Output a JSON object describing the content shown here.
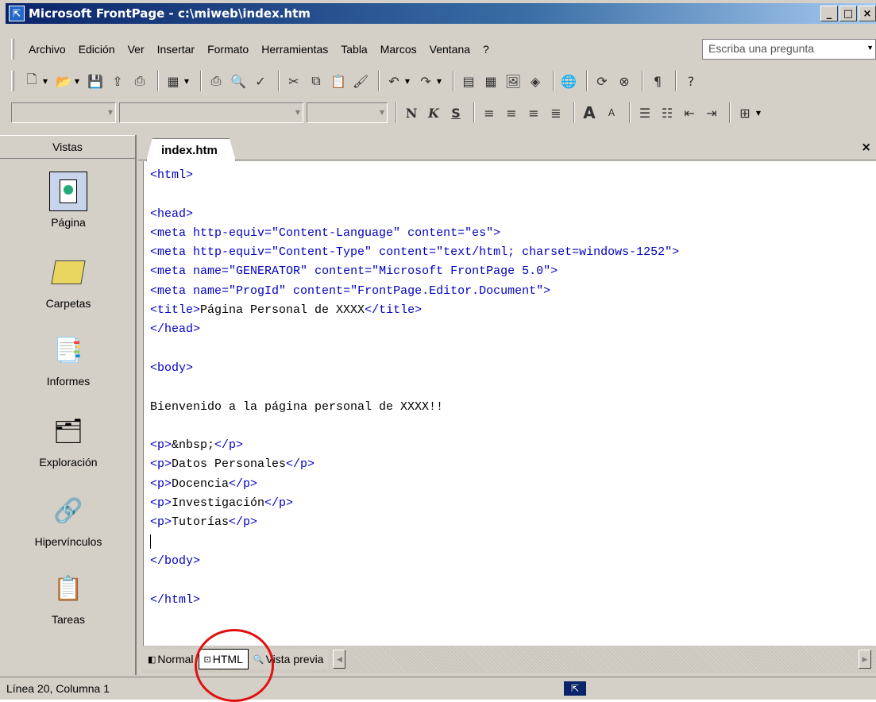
{
  "window": {
    "title": "Microsoft FrontPage - c:\\miweb\\index.htm",
    "app_icon": "frontpage-icon",
    "buttons": {
      "minimize": "_",
      "maximize": "□",
      "close": "×"
    }
  },
  "menubar": {
    "items": [
      "Archivo",
      "Edición",
      "Ver",
      "Insertar",
      "Formato",
      "Herramientas",
      "Tabla",
      "Marcos",
      "Ventana",
      "?"
    ],
    "ask_placeholder": "Escriba una pregunta"
  },
  "toolbar_icons": {
    "standard": [
      "new-page-icon",
      "open-icon",
      "save-icon",
      "publish-icon",
      "print-preview-icon",
      "insert-component-icon",
      "print-icon",
      "preview-in-browser-icon",
      "spelling-icon",
      "cut-icon",
      "copy-icon",
      "paste-icon",
      "format-painter-icon",
      "undo-icon",
      "redo-icon",
      "web-component-icon",
      "table-icon",
      "picture-icon",
      "drawing-icon",
      "hyperlink-icon",
      "refresh-icon",
      "stop-icon",
      "show-all-icon",
      "help-icon"
    ],
    "formatting": [
      "style-combo",
      "font-combo",
      "size-combo",
      "bold-button",
      "italic-button",
      "underline-button",
      "align-left-icon",
      "center-icon",
      "align-right-icon",
      "justify-icon",
      "increase-font-icon",
      "decrease-font-icon",
      "numbering-icon",
      "bullets-icon",
      "decrease-indent-icon",
      "increase-indent-icon",
      "borders-icon"
    ]
  },
  "formatting_labels": {
    "bold": "N",
    "italic": "K",
    "underline": "S"
  },
  "views_pane": {
    "header": "Vistas",
    "items": [
      {
        "label": "Página",
        "icon": "page-view-icon",
        "selected": true
      },
      {
        "label": "Carpetas",
        "icon": "folders-view-icon"
      },
      {
        "label": "Informes",
        "icon": "reports-view-icon"
      },
      {
        "label": "Exploración",
        "icon": "navigation-view-icon"
      },
      {
        "label": "Hipervínculos",
        "icon": "hyperlinks-view-icon"
      },
      {
        "label": "Tareas",
        "icon": "tasks-view-icon"
      }
    ]
  },
  "document": {
    "tab_label": "index.htm",
    "close_label": "×",
    "code": [
      "<html>",
      "",
      "<head>",
      "<meta http-equiv=\"Content-Language\" content=\"es\">",
      "<meta http-equiv=\"Content-Type\" content=\"text/html; charset=windows-1252\">",
      "<meta name=\"GENERATOR\" content=\"Microsoft FrontPage 5.0\">",
      "<meta name=\"ProgId\" content=\"FrontPage.Editor.Document\">",
      "<title>Página Personal de XXXX</title>",
      "</head>",
      "",
      "<body>",
      "",
      "Bienvenido a la página personal de XXXX!!",
      "",
      "<p>&nbsp;</p>",
      "<p>Datos Personales</p>",
      "<p>Docencia</p>",
      "<p>Investigación</p>",
      "<p>Tutorías</p>",
      "",
      "</body>",
      "",
      "</html>"
    ],
    "caret_line": 20
  },
  "view_tabs": [
    {
      "label": "Normal",
      "icon": "normal-view-icon"
    },
    {
      "label": "HTML",
      "icon": "html-view-icon",
      "active": true
    },
    {
      "label": "Vista previa",
      "icon": "preview-view-icon"
    }
  ],
  "statusbar": {
    "position": "Línea 20, Columna 1",
    "icon": "frontpage-status-icon"
  },
  "colors": {
    "titlebar_start": "#0a246a",
    "tag_color": "#0000c0",
    "annotation": "#e01010"
  }
}
